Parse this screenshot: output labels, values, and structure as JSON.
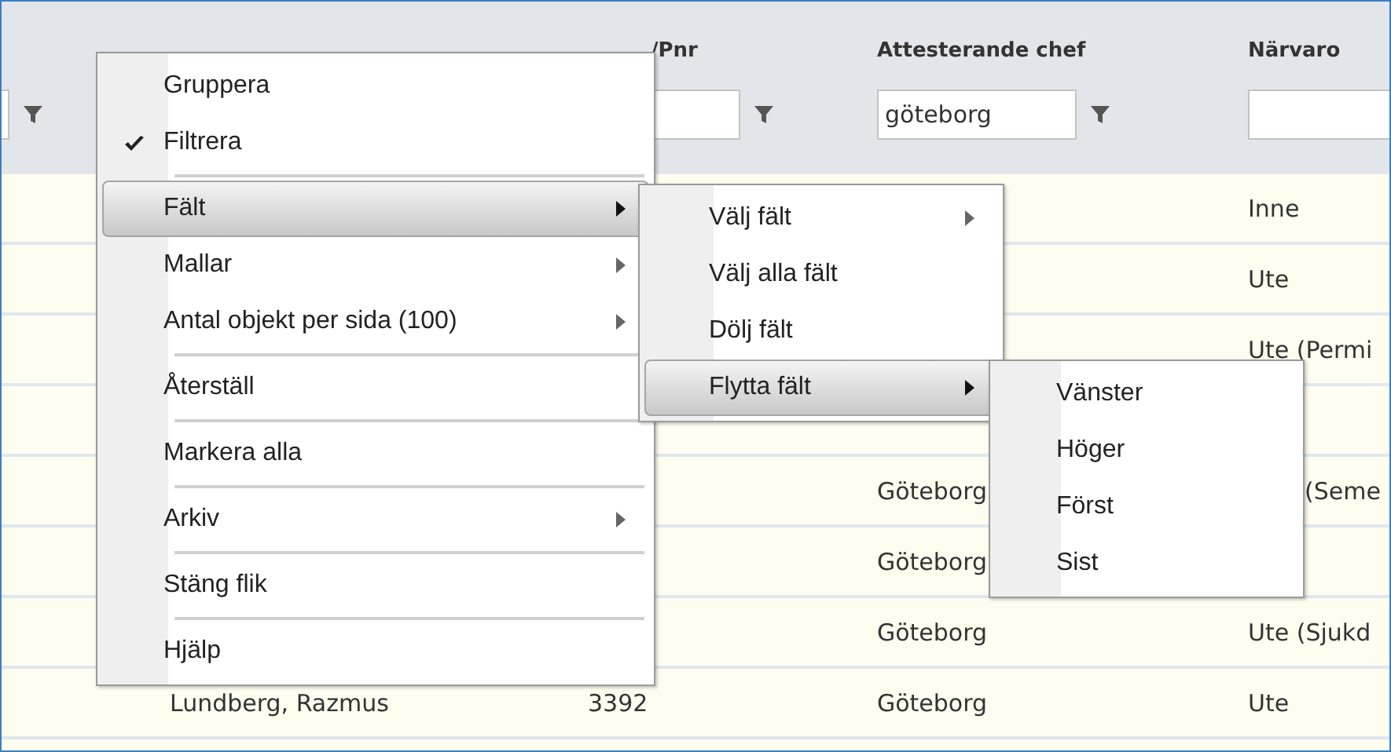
{
  "table": {
    "columns": [
      {
        "kind": "stub",
        "has_filter": true
      },
      {
        "kind": "name"
      },
      {
        "kind": "pnr",
        "header": "/Pnr",
        "has_filter": true
      },
      {
        "kind": "manager",
        "header": "Attesterande chef",
        "has_filter": true,
        "filter_value": "göteborg"
      },
      {
        "kind": "presence",
        "header": "Närvaro",
        "has_filter": true
      }
    ],
    "rows": [
      {
        "presence": "Inne"
      },
      {
        "presence": "Ute"
      },
      {
        "presence": "Ute (Permi"
      },
      {},
      {
        "manager": "Göteborg",
        "presence": "(Seme"
      },
      {
        "manager": "Göteborg"
      },
      {
        "manager": "Göteborg",
        "presence": "Ute (Sjukd"
      },
      {
        "name": "Lundberg, Razmus",
        "pnr": "3392",
        "manager": "Göteborg",
        "presence": "Ute"
      }
    ]
  },
  "context_menu": {
    "items": [
      {
        "kind": "item",
        "label": "Gruppera",
        "checked": false,
        "selected": false,
        "has_submenu": false
      },
      {
        "kind": "item",
        "label": "Filtrera",
        "checked": true,
        "selected": false,
        "has_submenu": false
      },
      {
        "kind": "separator"
      },
      {
        "kind": "item",
        "label": "Fält",
        "checked": false,
        "selected": true,
        "has_submenu": true
      },
      {
        "kind": "item",
        "label": "Mallar",
        "checked": false,
        "selected": false,
        "has_submenu": true
      },
      {
        "kind": "item",
        "label": "Antal objekt per sida (100)",
        "checked": false,
        "selected": false,
        "has_submenu": true
      },
      {
        "kind": "separator"
      },
      {
        "kind": "item",
        "label": "Återställ",
        "checked": false,
        "selected": false,
        "has_submenu": false
      },
      {
        "kind": "separator"
      },
      {
        "kind": "item",
        "label": "Markera alla",
        "checked": false,
        "selected": false,
        "has_submenu": false
      },
      {
        "kind": "separator"
      },
      {
        "kind": "item",
        "label": "Arkiv",
        "checked": false,
        "selected": false,
        "has_submenu": true
      },
      {
        "kind": "separator"
      },
      {
        "kind": "item",
        "label": "Stäng flik",
        "checked": false,
        "selected": false,
        "has_submenu": false
      },
      {
        "kind": "separator"
      },
      {
        "kind": "item",
        "label": "Hjälp",
        "checked": false,
        "selected": false,
        "has_submenu": false
      }
    ]
  },
  "submenu": {
    "items": [
      {
        "kind": "item",
        "label": "Välj fält",
        "checked": false,
        "selected": false,
        "has_submenu": true
      },
      {
        "kind": "item",
        "label": "Välj alla fält",
        "checked": false,
        "selected": false,
        "has_submenu": false
      },
      {
        "kind": "item",
        "label": "Dölj fält",
        "checked": false,
        "selected": false,
        "has_submenu": false
      },
      {
        "kind": "item",
        "label": "Flytta fält",
        "checked": false,
        "selected": true,
        "has_submenu": true
      }
    ]
  },
  "submenu_2": {
    "items": [
      {
        "kind": "item",
        "label": "Vänster",
        "checked": false,
        "selected": false,
        "has_submenu": false
      },
      {
        "kind": "item",
        "label": "Höger",
        "checked": false,
        "selected": false,
        "has_submenu": false
      },
      {
        "kind": "item",
        "label": "Först",
        "checked": false,
        "selected": false,
        "has_submenu": false
      },
      {
        "kind": "item",
        "label": "Sist",
        "checked": false,
        "selected": false,
        "has_submenu": false
      }
    ]
  }
}
